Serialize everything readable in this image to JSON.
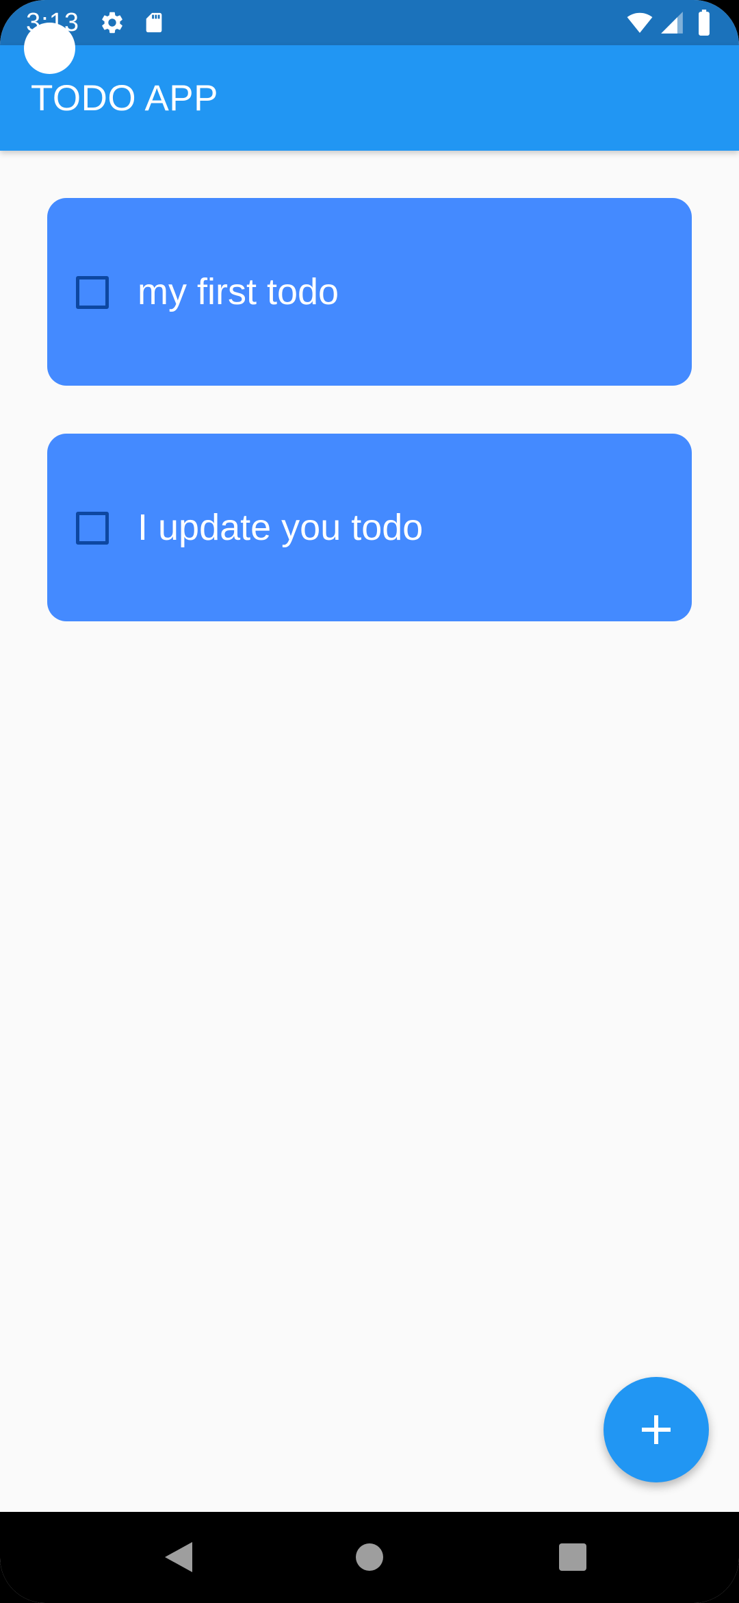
{
  "status_bar": {
    "time": "3:13",
    "left_icons": [
      "gear-icon",
      "sd-card-icon"
    ],
    "right_icons": [
      "wifi-icon",
      "signal-icon",
      "battery-icon"
    ],
    "background": "#1b72bb"
  },
  "app_bar": {
    "title": "TODO APP",
    "background": "#2196f3"
  },
  "todos": [
    {
      "text": "my first todo",
      "checked": false
    },
    {
      "text": "I update you todo",
      "checked": false
    }
  ],
  "card_color": "#448aff",
  "fab": {
    "icon": "plus-icon",
    "color": "#2196f3"
  },
  "nav_bar": {
    "buttons": [
      "back-icon",
      "home-icon",
      "recents-icon"
    ]
  }
}
